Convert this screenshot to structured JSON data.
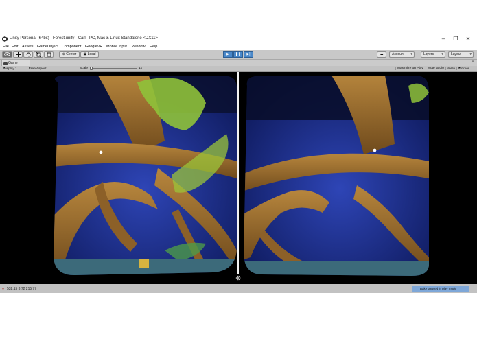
{
  "window": {
    "title": "Unity Personal (64bit) - Forest.unity - Carl - PC, Mac & Linux Standalone <DX11>",
    "controls": [
      "–",
      "❐",
      "✕"
    ]
  },
  "menu": [
    "File",
    "Edit",
    "Assets",
    "GameObject",
    "Component",
    "GoogleVR",
    "Mobile Input",
    "Window",
    "Help"
  ],
  "toolbar": {
    "tools": [
      "hand-tool",
      "move-tool",
      "rotate-tool",
      "scale-tool",
      "rect-tool"
    ],
    "pivot_label": "Center",
    "space_label": "Local",
    "play_buttons": [
      "play",
      "pause",
      "step"
    ],
    "cloud_icon": "cloud-icon",
    "account_label": "Account",
    "layers_label": "Layers",
    "layout_label": "Layout"
  },
  "game_panel": {
    "tab_label": "Game",
    "display_label": "Display 1",
    "aspect_label": "Free Aspect",
    "scale_label": "Scale",
    "scale_value": "1x",
    "maximize_label": "Maximize on Play",
    "mute_label": "Mute audio",
    "stats_label": "Stats",
    "gizmos_label": "Gizmos",
    "settings_icon": "gear-icon"
  },
  "status": {
    "coords": "532.15 3.72 215.77",
    "bake_message": "Bake paused in play mode"
  },
  "colors": {
    "play_active": "#4a88c9",
    "sky": "#1a2d86",
    "bark": "#9a6a30",
    "leaves": "#8fc23a"
  }
}
